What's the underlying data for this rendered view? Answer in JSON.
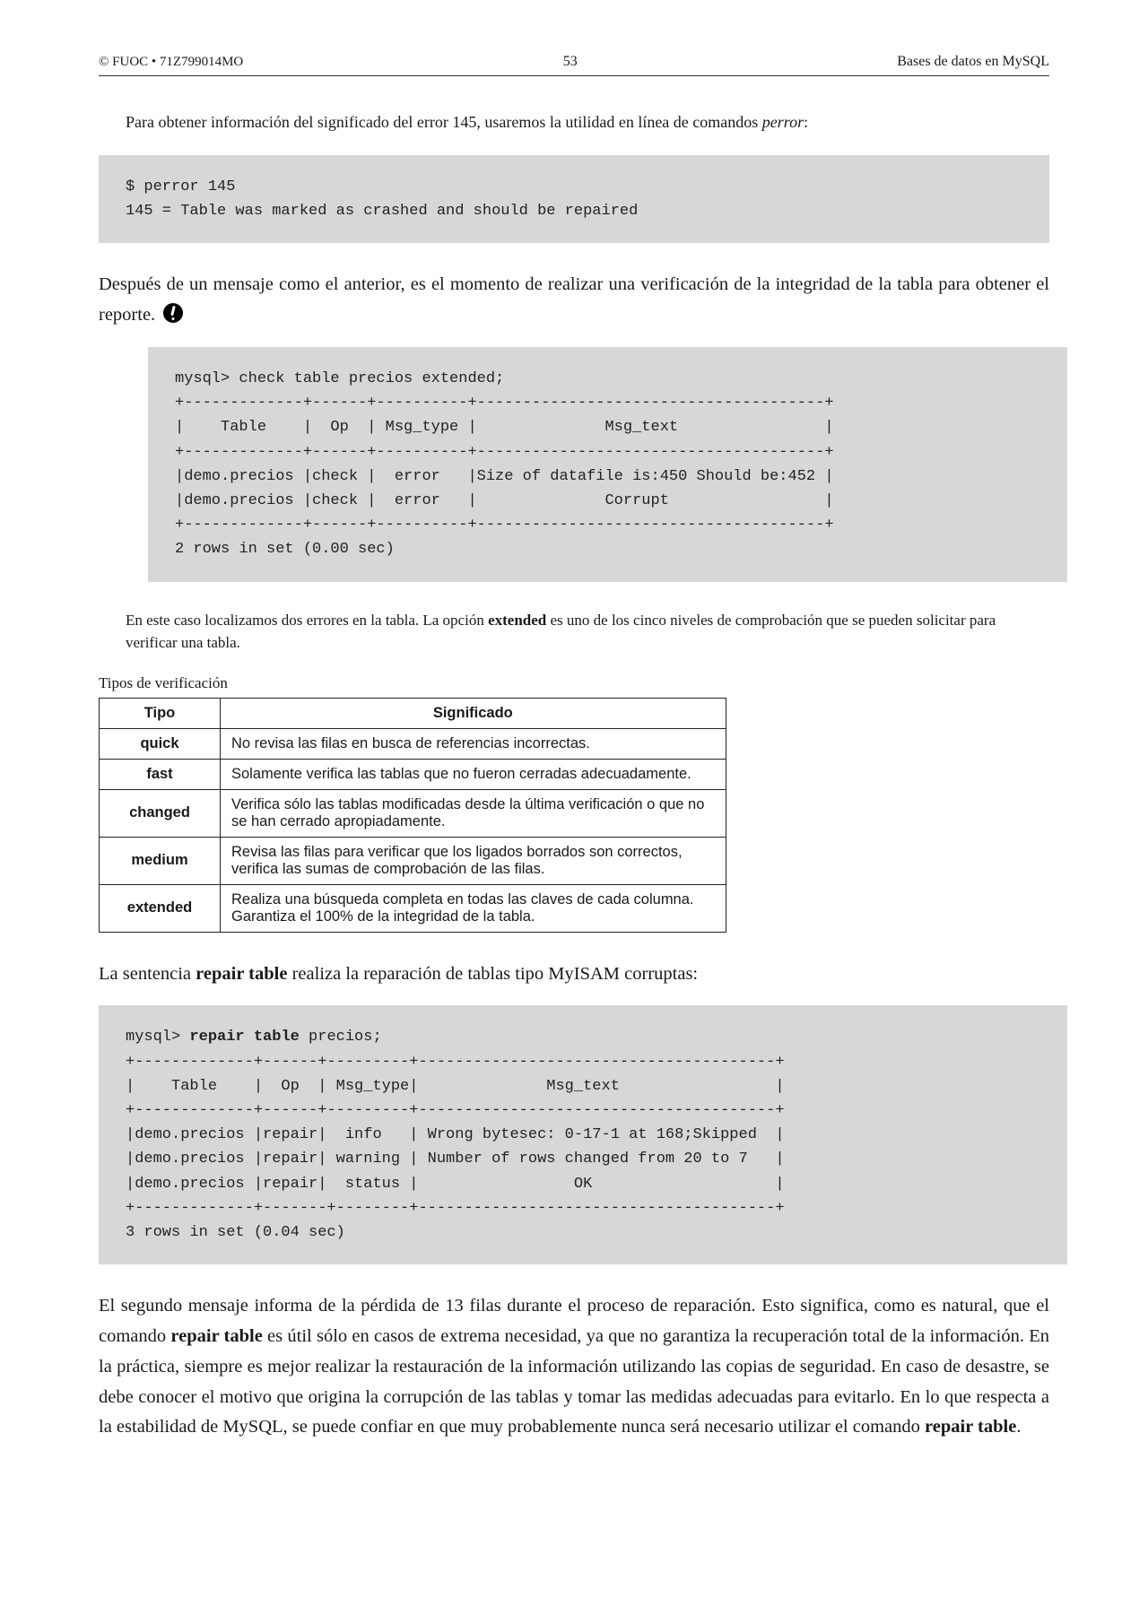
{
  "header": {
    "left": "© FUOC • 71Z799014MO",
    "center": "53",
    "right": "Bases de datos en MySQL"
  },
  "intro1_a": "Para obtener información del significado del error 145, usaremos la utilidad en línea de comandos ",
  "intro1_b": "perror",
  "intro1_c": ":",
  "code1": "$ perror 145\n145 = Table was marked as crashed and should be repaired",
  "para1_a": "Después de un mensaje como el anterior, es el momento de realizar una verificación de la integridad de la tabla para obtener el reporte.",
  "code2": "mysql> check table precios extended;\n+-------------+------+----------+--------------------------------------+\n|    Table    |  Op  | Msg_type |              Msg_text                |\n+-------------+------+----------+--------------------------------------+\n|demo.precios |check |  error   |Size of datafile is:450 Should be:452 |\n|demo.precios |check |  error   |              Corrupt                 |\n+-------------+------+----------+--------------------------------------+\n2 rows in set (0.00 sec)",
  "note2_a": "En este caso localizamos dos errores en la tabla. La opción ",
  "note2_b": "extended",
  "note2_c": " es uno de los cinco niveles de comprobación que se pueden solicitar para verificar una tabla.",
  "table_caption": "Tipos de verificación",
  "table": {
    "head": {
      "c1": "Tipo",
      "c2": "Significado"
    },
    "rows": [
      {
        "type": "quick",
        "desc": "No revisa las filas en busca de referencias incorrectas."
      },
      {
        "type": "fast",
        "desc": "Solamente verifica las tablas que no fueron cerradas adecuadamente."
      },
      {
        "type": "changed",
        "desc": "Verifica sólo las tablas modificadas desde la última verificación o que no se han cerrado apropiadamente."
      },
      {
        "type": "medium",
        "desc": "Revisa las filas para verificar que los ligados borrados son correctos, verifica las sumas de comprobación de las filas."
      },
      {
        "type": "extended",
        "desc": "Realiza una búsqueda completa en todas las claves de cada columna. Garantiza el 100% de la integridad de la tabla."
      }
    ]
  },
  "para2_a": "La sentencia ",
  "para2_b": "repair table",
  "para2_c": " realiza la reparación de tablas tipo MyISAM corruptas:",
  "code3_prefix": "mysql> ",
  "code3_bold": "repair table",
  "code3_suffix": " precios;\n+-------------+------+---------+---------------------------------------+\n|    Table    |  Op  | Msg_type|              Msg_text                 |\n+-------------+------+---------+---------------------------------------+\n|demo.precios |repair|  info   | Wrong bytesec: 0-17-1 at 168;Skipped  |\n|demo.precios |repair| warning | Number of rows changed from 20 to 7   |\n|demo.precios |repair|  status |                 OK                    |\n+-------------+-------+--------+---------------------------------------+\n3 rows in set (0.04 sec)",
  "para3_a": "El segundo mensaje informa de la pérdida de 13 filas durante el proceso de reparación. Esto significa, como es natural, que el comando ",
  "para3_b": "repair table",
  "para3_c": " es útil sólo en casos de extrema necesidad, ya que no garantiza la recuperación total de la información. En la práctica, siempre es mejor realizar la restauración de la información utilizando las copias de seguridad. En caso de desastre, se debe conocer el motivo que origina la corrupción de las tablas y tomar las medidas adecuadas para evitarlo. En lo que respecta a la estabilidad de MySQL, se puede confiar en que muy probablemente nunca será necesario utilizar el comando ",
  "para3_d": "repair table",
  "para3_e": "."
}
